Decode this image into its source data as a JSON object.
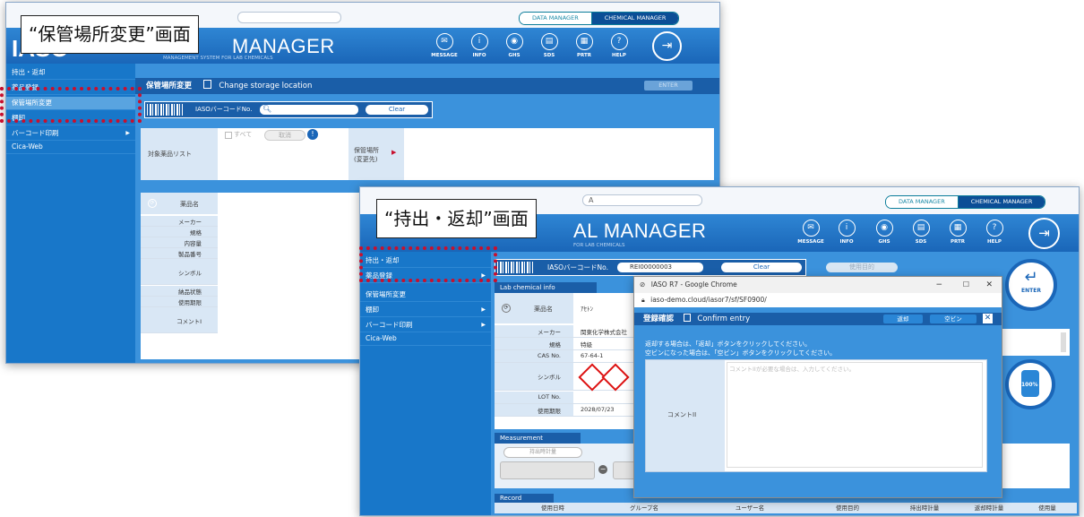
{
  "colors": {
    "header_blue": "#1a66b8",
    "sidebar_blue": "#1877c9",
    "callout_red": "#c8102e",
    "dark_nav": "#0b4e96"
  },
  "callouts": {
    "storage_change": "“保管場所変更”画面",
    "checkout_return": "“持出・返却”画面"
  },
  "common": {
    "data_manager": "DATA MANAGER",
    "chemical_manager": "CHEMICAL MANAGER",
    "brand": "MANAGER",
    "brand_full": "AL MANAGER",
    "subtitle_left": "MANAGEMENT SYSTEM FOR LAB CHEMICALS",
    "subtitle_right": "FOR LAB CHEMICALS",
    "nav": [
      {
        "label": "MESSAGE",
        "icon": "message-icon",
        "glyph": "✉"
      },
      {
        "label": "INFO",
        "icon": "info-icon",
        "glyph": "i"
      },
      {
        "label": "GHS",
        "icon": "ghs-icon",
        "glyph": "◉"
      },
      {
        "label": "SDS",
        "icon": "sds-icon",
        "glyph": "▤"
      },
      {
        "label": "PRTR",
        "icon": "prtr-icon",
        "glyph": "▦"
      },
      {
        "label": "HELP",
        "icon": "help-icon",
        "glyph": "?"
      }
    ],
    "exit_glyph": "⇥",
    "logo_fragment": "IASO",
    "search_fragment": "A"
  },
  "left": {
    "sidebar": [
      "持出・返却",
      "薬品登録",
      "保管場所変更",
      "棚卸",
      "バーコード印刷",
      "Cica-Web"
    ],
    "title_jp": "保管場所変更",
    "title_en": "Change storage location",
    "enter": "ENTER",
    "barcode_label": "IASOバーコードNo.",
    "clear": "Clear",
    "all": "すべて",
    "cancel": "取消",
    "target_list": "対象薬品リスト",
    "dest_label": "保管場所\n(変更先)",
    "drug_name": "薬品名",
    "rows": [
      "メーカー",
      "規格",
      "内容量",
      "製品番号",
      "シンボル",
      "納品状態",
      "使用期限",
      "コメントI"
    ]
  },
  "right": {
    "sidebar": [
      "持出・返却",
      "薬品登録",
      "保管場所変更",
      "棚卸",
      "バーコード印刷",
      "Cica-Web"
    ],
    "barcode_label": "IASOバーコードNo.",
    "barcode_value": "REI00000003",
    "clear": "Clear",
    "purpose_btn": "使用目的",
    "enter": "ENTER",
    "lab_chem_info": "Lab chemical info",
    "drug_name_label": "薬品名",
    "drug_name_value": "ｱｾﾄﾝ",
    "info_rows": [
      {
        "label": "メーカー",
        "value": "関東化学株式会社"
      },
      {
        "label": "規格",
        "value": "特級"
      },
      {
        "label": "CAS No.",
        "value": "67-64-1"
      },
      {
        "label": "シンボル",
        "value": ""
      },
      {
        "label": "LOT No.",
        "value": ""
      },
      {
        "label": "使用期限",
        "value": "2028/07/23"
      }
    ],
    "measurement": "Measurement",
    "checkout_weight_btn": "持出時計量",
    "record": "Record",
    "record_cols": [
      "使用日時",
      "グループ名",
      "ユーザー名",
      "使用目的",
      "持出時計量",
      "返却時計量",
      "使用量"
    ],
    "gauge": "100%"
  },
  "dialog": {
    "window_title": "IASO R7 - Google Chrome",
    "url": "iaso-demo.cloud/iasor7/sf/SF0900/",
    "title_jp": "登録確認",
    "title_en": "Confirm entry",
    "return_btn": "返却",
    "empty_btn": "空ビン",
    "msg1": "返却する場合は、「返却」ボタンをクリックしてください。",
    "msg2": "空ビンになった場合は、「空ビン」ボタンをクリックしてください。",
    "comment_label": "コメントII",
    "comment_placeholder": "コメントIIが必要な場合は、入力してください。"
  }
}
